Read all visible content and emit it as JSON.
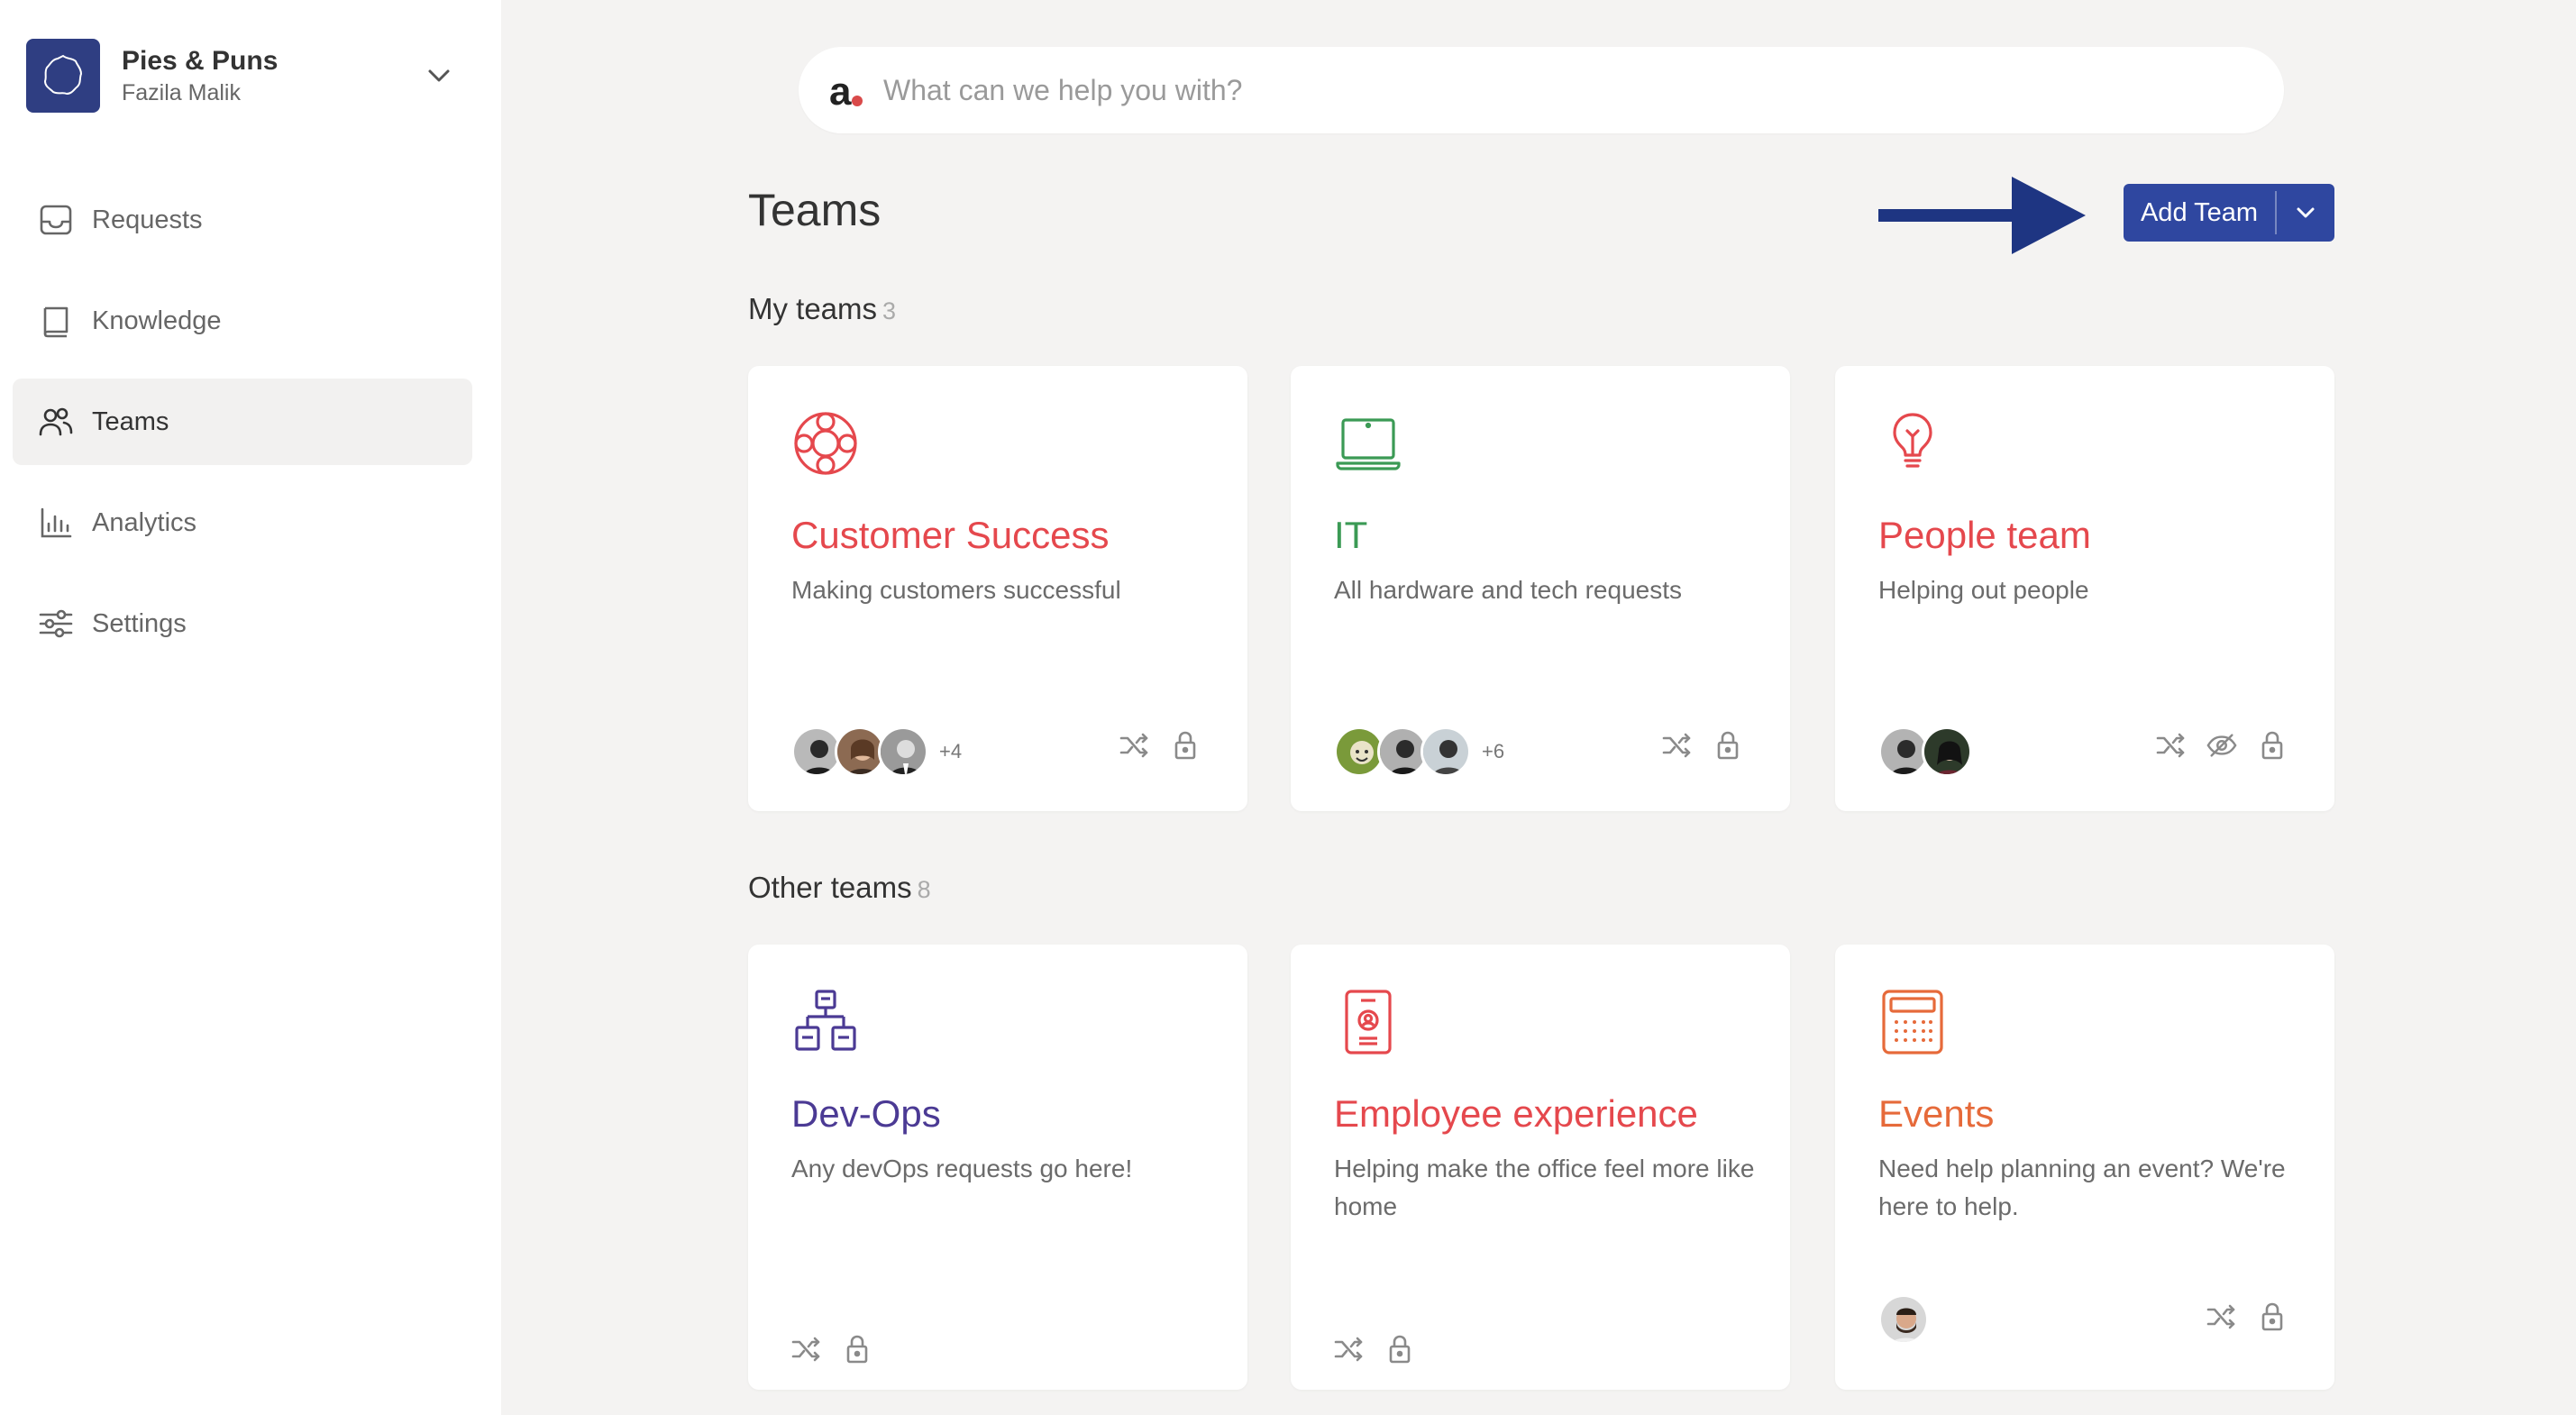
{
  "colors": {
    "accent": "#2f47a0",
    "red": "#e5484d",
    "green": "#3b9a55",
    "purple": "#4b3a94",
    "orange": "#e66a3a"
  },
  "workspace": {
    "name": "Pies & Puns",
    "user": "Fazila Malik"
  },
  "sidebar": {
    "items": [
      {
        "label": "Requests",
        "icon": "inbox-icon"
      },
      {
        "label": "Knowledge",
        "icon": "book-icon"
      },
      {
        "label": "Teams",
        "icon": "users-icon",
        "active": true
      },
      {
        "label": "Analytics",
        "icon": "bar-chart-icon"
      },
      {
        "label": "Settings",
        "icon": "sliders-icon"
      }
    ]
  },
  "search": {
    "placeholder": "What can we help you with?",
    "logo_letter": "a"
  },
  "page": {
    "title": "Teams",
    "add_team_label": "Add Team"
  },
  "sections": {
    "my": {
      "title": "My teams",
      "count": "3"
    },
    "other": {
      "title": "Other teams",
      "count": "8"
    }
  },
  "cards": [
    {
      "name": "Customer Success",
      "desc": "Making customers successful",
      "more": "+4",
      "icon": "lifebuoy-icon",
      "color": "#e5484d"
    },
    {
      "name": "IT",
      "desc": "All hardware and tech requests",
      "more": "+6",
      "icon": "laptop-icon",
      "color": "#3b9a55"
    },
    {
      "name": "People team",
      "desc": "Helping out people",
      "more": "",
      "icon": "lightbulb-icon",
      "color": "#e5484d"
    },
    {
      "name": "Dev-Ops",
      "desc": "Any devOps requests go here!",
      "more": "",
      "icon": "hierarchy-icon",
      "color": "#4b3a94"
    },
    {
      "name": "Employee experience",
      "desc": "Helping make the office feel more like home",
      "more": "",
      "icon": "id-badge-icon",
      "color": "#e5484d"
    },
    {
      "name": "Events",
      "desc": "Need help planning an event? We're here to help.",
      "more": "",
      "icon": "calendar-icon",
      "color": "#e66a3a"
    }
  ]
}
